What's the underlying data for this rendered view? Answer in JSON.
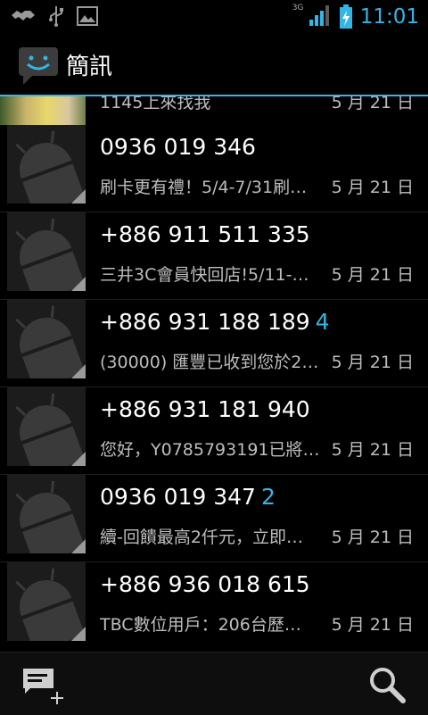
{
  "status_bar": {
    "network": "3G",
    "time": "11:01"
  },
  "app": {
    "title": "簡訊"
  },
  "partial_row": {
    "snippet": "1145上來找我",
    "date": "5 月 21 日"
  },
  "threads": [
    {
      "name": "0936 019 346",
      "count": "",
      "snippet": "刷卡更有禮！5/4-7/31刷…",
      "date": "5 月 21 日"
    },
    {
      "name": "+886 911 511 335",
      "count": "",
      "snippet": "三井3C會員快回店!5/11-…",
      "date": "5 月 21 日"
    },
    {
      "name": "+886 931 188 189",
      "count": "4",
      "snippet": "(30000) 匯豐已收到您於2…",
      "date": "5 月 21 日"
    },
    {
      "name": "+886 931 181 940",
      "count": "",
      "snippet": "您好，Y0785793191已將…",
      "date": "5 月 21 日"
    },
    {
      "name": "0936 019 347",
      "count": "2",
      "snippet": "續-回饋最高2仟元，立即…",
      "date": "5 月 21 日"
    },
    {
      "name": "+886 936 018 615",
      "count": "",
      "snippet": "TBC數位用戶：206台歷…",
      "date": "5 月 21 日"
    }
  ],
  "colors": {
    "accent": "#33b5e5",
    "background": "#000000"
  }
}
